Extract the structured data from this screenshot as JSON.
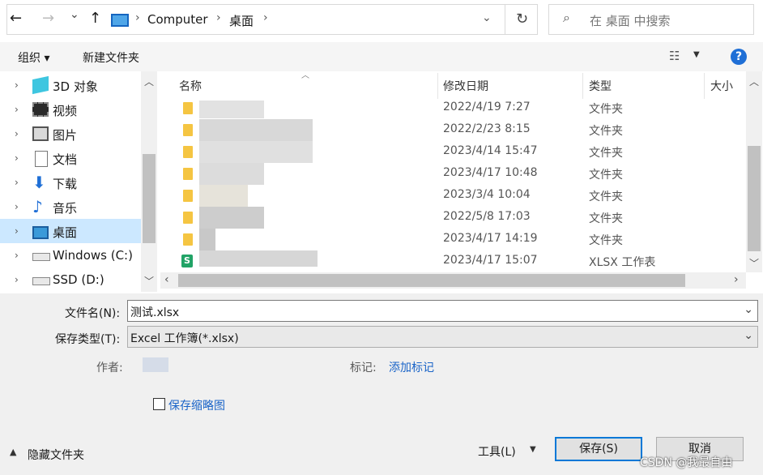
{
  "nav_buttons": {
    "back": "←",
    "forward": "→",
    "recent": "⌄",
    "up": "↑"
  },
  "address": {
    "crumbs": [
      "Computer",
      "桌面"
    ],
    "refresh": "↻"
  },
  "search": {
    "placeholder": "在 桌面 中搜索"
  },
  "toolbar": {
    "organize": "组织 ▾",
    "new_folder": "新建文件夹",
    "help": "?"
  },
  "nav_pane": {
    "items": [
      {
        "label": "3D 对象",
        "icon": "3d-objects-icon"
      },
      {
        "label": "视频",
        "icon": "video-icon"
      },
      {
        "label": "图片",
        "icon": "pictures-icon"
      },
      {
        "label": "文档",
        "icon": "documents-icon"
      },
      {
        "label": "下载",
        "icon": "downloads-icon"
      },
      {
        "label": "音乐",
        "icon": "music-icon"
      },
      {
        "label": "桌面",
        "icon": "desktop-icon",
        "selected": true
      },
      {
        "label": "Windows (C:)",
        "icon": "drive-c-icon"
      },
      {
        "label": "SSD (D:)",
        "icon": "drive-d-icon"
      }
    ]
  },
  "columns": {
    "name": "名称",
    "modified": "修改日期",
    "type": "类型",
    "size": "大小"
  },
  "files": [
    {
      "modified": "2022/4/19 7:27",
      "type": "文件夹",
      "icon": "folder-icon"
    },
    {
      "modified": "2022/2/23 8:15",
      "type": "文件夹",
      "icon": "folder-icon"
    },
    {
      "modified": "2023/4/14 15:47",
      "type": "文件夹",
      "icon": "folder-icon"
    },
    {
      "modified": "2023/4/17 10:48",
      "type": "文件夹",
      "icon": "folder-icon"
    },
    {
      "modified": "2023/3/4 10:04",
      "type": "文件夹",
      "icon": "folder-icon"
    },
    {
      "modified": "2022/5/8 17:03",
      "type": "文件夹",
      "icon": "folder-icon"
    },
    {
      "modified": "2023/4/17 14:19",
      "type": "文件夹",
      "icon": "folder-icon"
    },
    {
      "modified": "2023/4/17 15:07",
      "type": "XLSX 工作表",
      "icon": "xlsx-file-icon"
    }
  ],
  "form": {
    "filename_label": "文件名(N):",
    "filename_value": "测试.xlsx",
    "filetype_label": "保存类型(T):",
    "filetype_value": "Excel 工作簿(*.xlsx)",
    "author_label": "作者:",
    "tags_label": "标记:",
    "tags_link": "添加标记",
    "thumbnail_label": "保存缩略图",
    "hide_folders": "隐藏文件夹",
    "tools": "工具(L)",
    "save": "保存(S)",
    "cancel": "取消"
  },
  "watermark": "CSDN @我最自由",
  "colors": {
    "accent": "#0078d7",
    "selection": "#cce8ff",
    "link": "#1a64c8",
    "folder": "#f5c542",
    "xlsx": "#21a366"
  }
}
